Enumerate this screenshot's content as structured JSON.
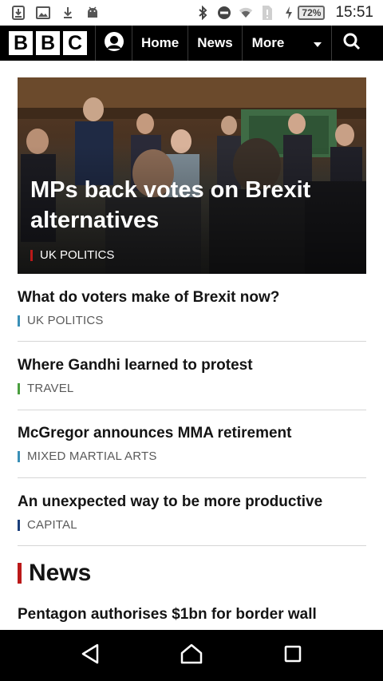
{
  "status_bar": {
    "time": "15:51",
    "battery": "72%",
    "left_icons": [
      "download-box-icon",
      "image-icon",
      "download-arrow-icon",
      "android-icon"
    ],
    "right_icons": [
      "bluetooth-icon",
      "do-not-disturb-icon",
      "wifi-icon",
      "sim-alert-icon",
      "charging-icon"
    ]
  },
  "nav": {
    "logo_letters": [
      "B",
      "B",
      "C"
    ],
    "links": [
      "Home",
      "News"
    ],
    "more_label": "More"
  },
  "hero": {
    "title": "MPs back votes on Brexit alternatives",
    "tag": "UK POLITICS",
    "tag_color": "#bb1919"
  },
  "stories": [
    {
      "title": "What do voters make of Brexit now?",
      "tag": "UK POLITICS",
      "tag_color": "#3a8fb7"
    },
    {
      "title": "Where Gandhi learned to protest",
      "tag": "TRAVEL",
      "tag_color": "#4a9e3f"
    },
    {
      "title": "McGregor announces MMA retirement",
      "tag": "MIXED MARTIAL ARTS",
      "tag_color": "#3a8fb7"
    },
    {
      "title": "An unexpected way to be more productive",
      "tag": "CAPITAL",
      "tag_color": "#1a3e7a"
    }
  ],
  "section": {
    "title": "News",
    "color": "#bb1919"
  },
  "next_story": {
    "title": "Pentagon authorises $1bn for border wall"
  },
  "system_nav": [
    "back-icon",
    "home-icon",
    "recents-icon"
  ]
}
